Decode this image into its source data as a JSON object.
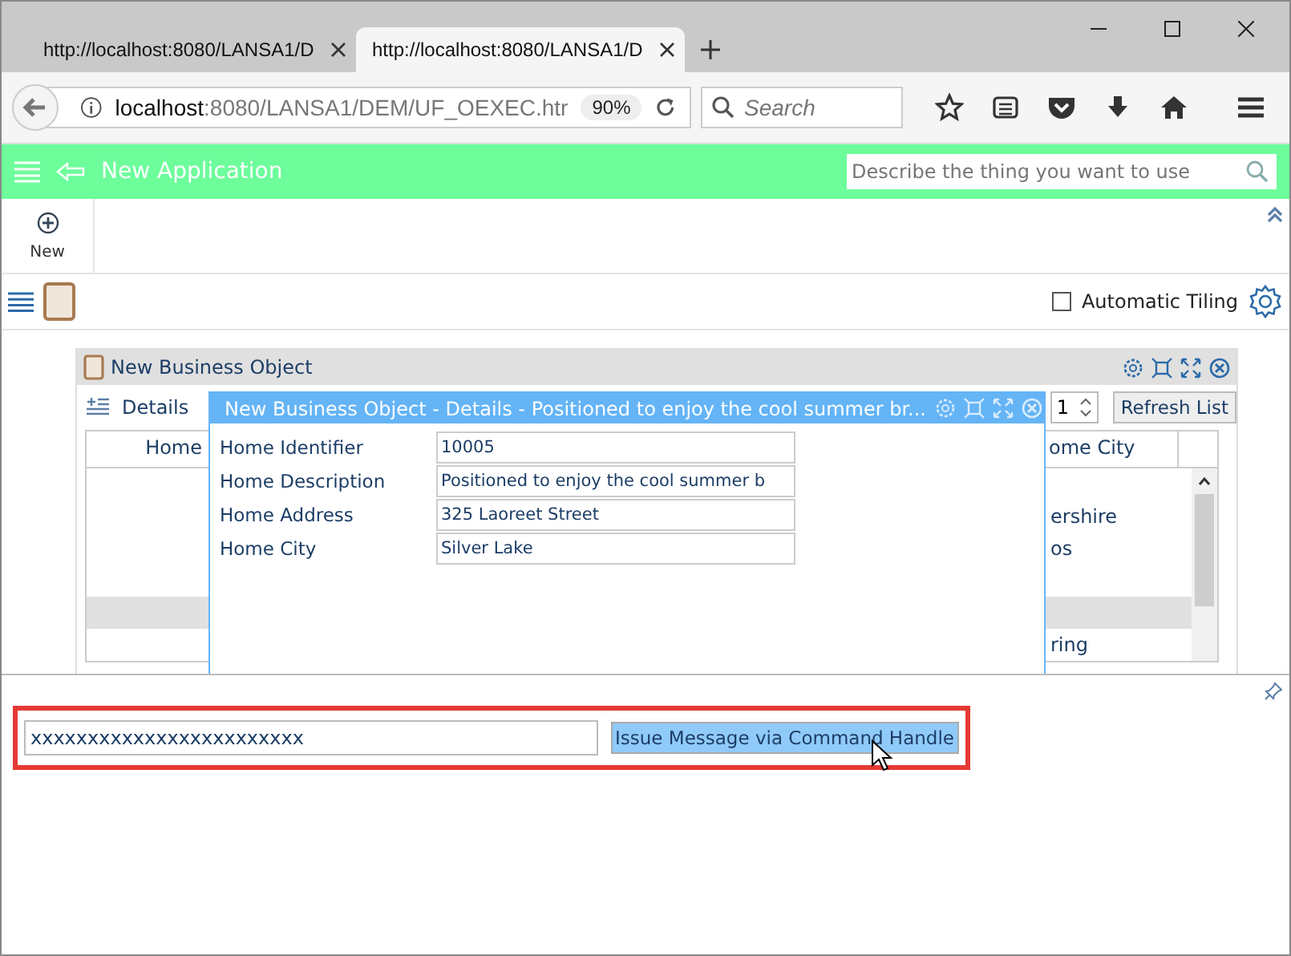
{
  "browser": {
    "tabs": [
      {
        "title": "http://localhost:8080/LANSA1/D",
        "selected": false
      },
      {
        "title": "http://localhost:8080/LANSA1/D",
        "selected": true
      }
    ],
    "url_host": "localhost",
    "url_rest": ":8080/LANSA1/DEM/UF_OEXEC.htr",
    "zoom": "90%",
    "search_placeholder": "Search"
  },
  "app_bar": {
    "title": "New Application",
    "search_placeholder": "Describe the thing you want to use"
  },
  "toolbar": {
    "new_label": "New",
    "tiling_label": "Automatic Tiling",
    "tiling_checked": false
  },
  "business_object": {
    "title": "New Business Object",
    "tab": "Details",
    "spinner": "1",
    "refresh": "Refresh List",
    "columns": [
      "Home",
      "ome City"
    ],
    "rows": [
      {
        "selected": false
      },
      {
        "city": "ershire",
        "selected": false
      },
      {
        "city": "os",
        "selected": false
      },
      {
        "selected": false
      },
      {
        "selected": true
      },
      {
        "city": "ring",
        "selected": false
      }
    ]
  },
  "details_window": {
    "title": "New Business Object - Details - Positioned to enjoy the cool summer br...",
    "fields": [
      {
        "label": "Home Identifier",
        "value": "10005"
      },
      {
        "label": "Home Description",
        "value": "Positioned to enjoy the cool summer b"
      },
      {
        "label": "Home Address",
        "value": "325 Laoreet Street"
      },
      {
        "label": "Home City",
        "value": "Silver Lake"
      }
    ]
  },
  "command_panel": {
    "input_value": "xxxxxxxxxxxxxxxxxxxxxxxx",
    "button": "Issue Message via Command Handle"
  }
}
